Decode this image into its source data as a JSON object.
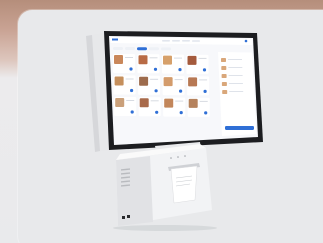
{
  "scene": {
    "subject": "pos-terminal",
    "colors": {
      "backdrop_top": "#b58e7b",
      "backdrop_bottom": "#e9eaec",
      "device_body": "#f4f4f5",
      "device_shadow": "#cfd1d4",
      "screen_bezel": "#1c1d20",
      "screen_bg": "#f7f8fb",
      "accent": "#2f6fd6"
    }
  },
  "screen": {
    "menu_items": [
      {
        "color": "#c9875a"
      },
      {
        "color": "#b86b45"
      },
      {
        "color": "#d6a06a"
      },
      {
        "color": "#a45a3c"
      },
      {
        "color": "#c58f5c"
      },
      {
        "color": "#9d6b4c"
      },
      {
        "color": "#d39b6b"
      },
      {
        "color": "#b77853"
      },
      {
        "color": "#caa07a"
      },
      {
        "color": "#a86a4a"
      },
      {
        "color": "#c2865b"
      },
      {
        "color": "#b5825d"
      }
    ]
  }
}
